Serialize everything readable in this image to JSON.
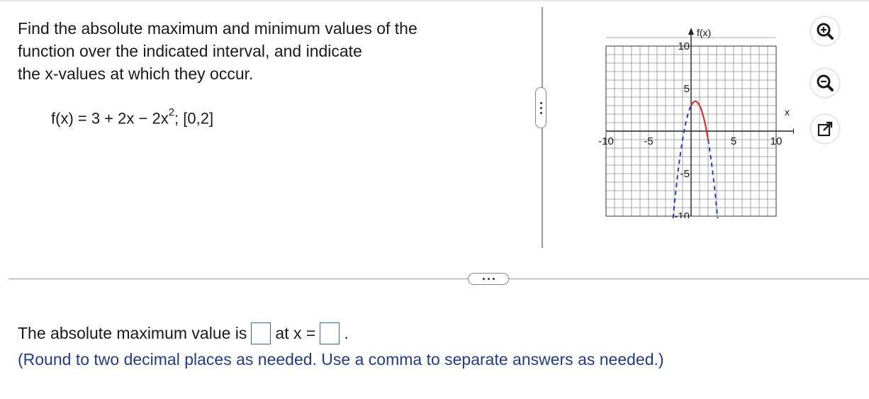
{
  "question": {
    "line1": "Find the absolute maximum and minimum values of the",
    "line2": "function over the indicated interval, and indicate",
    "line3": "the x-values at which they occur."
  },
  "formula": {
    "prefix": "f(x) = 3 + 2x − 2x",
    "exponent": "2",
    "suffix": "; [0,2]"
  },
  "graph": {
    "y_axis_label": "f(x)",
    "x_axis_label": "x",
    "x_tick_labels": [
      "-10",
      "-5",
      "5",
      "10"
    ],
    "y_tick_labels": [
      "10",
      "5",
      "-5",
      "-10"
    ],
    "curve_color": "#d9231c",
    "dashed_color": "#1f3fd1"
  },
  "tools": {
    "zoom_in": "zoom-in-icon",
    "zoom_out": "zoom-out-icon",
    "popout": "popout-icon"
  },
  "answer": {
    "prefix": "The absolute maximum value is",
    "middle": "at x =",
    "suffix": ".",
    "hint": "(Round to two decimal places as needed. Use a comma to separate answers as needed.)"
  }
}
